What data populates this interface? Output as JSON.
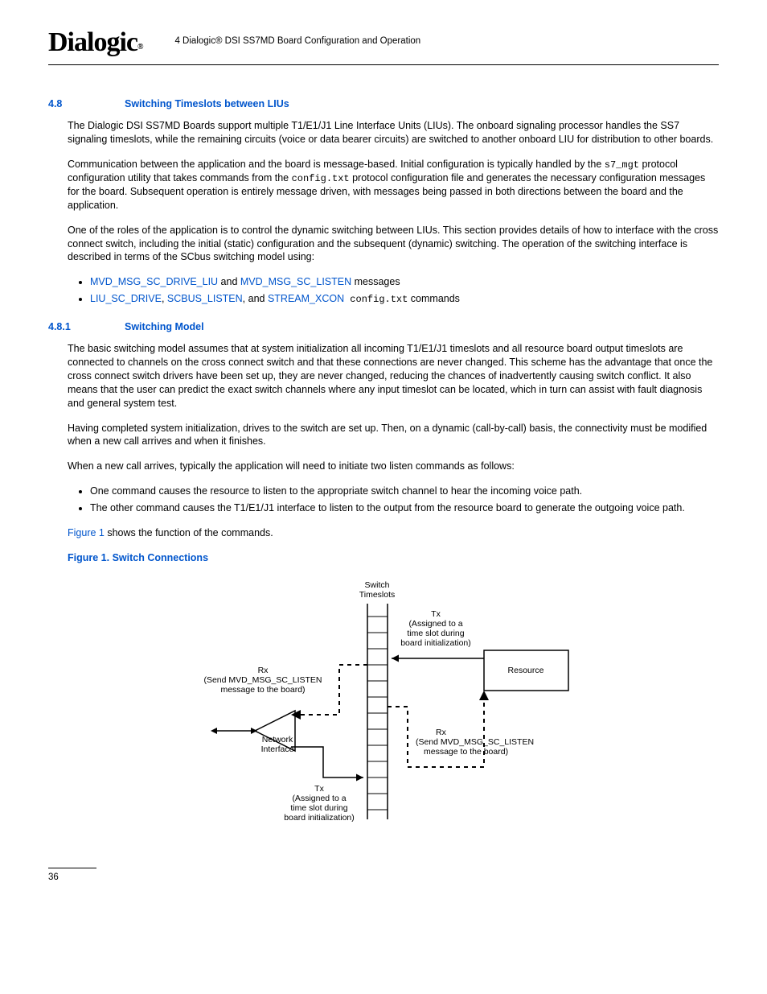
{
  "header": {
    "logo": "Dialogic",
    "running_title": "4 Dialogic® DSI SS7MD Board Configuration and Operation"
  },
  "sections": {
    "s48": {
      "num": "4.8",
      "title": "Switching Timeslots between LIUs",
      "paras": {
        "p1": "The Dialogic DSI SS7MD Boards support multiple T1/E1/J1 Line Interface Units (LIUs). The onboard signaling processor handles the SS7 signaling timeslots, while the remaining circuits (voice or data bearer circuits) are switched to another onboard LIU for distribution to other boards.",
        "p2a": "Communication between the application and the board is message-based. Initial configuration is typically handled by the ",
        "p2_code1": "s7_mgt",
        "p2b": " protocol configuration utility that takes commands from the ",
        "p2_code2": "config.txt",
        "p2c": " protocol configuration file and generates the necessary configuration messages for the board. Subsequent operation is entirely message driven, with messages being passed in both directions between the board and the application.",
        "p3": "One of the roles of the application is to control the dynamic switching between LIUs. This section provides details of how to interface with the cross connect switch, including the initial (static) configuration and the subsequent (dynamic) switching. The operation of the switching interface is described in terms of the SCbus switching model using:",
        "b1_link1": "MVD_MSG_SC_DRIVE_LIU",
        "b1_mid": " and ",
        "b1_link2": "MVD_MSG_SC_LISTEN",
        "b1_tail": " messages",
        "b2_link1": "LIU_SC_DRIVE",
        "b2_sep1": ", ",
        "b2_link2": "SCBUS_LISTEN",
        "b2_sep2": ", and ",
        "b2_link3": "STREAM_XCON",
        "b2_tail_code": " config.txt",
        "b2_tail": " commands"
      }
    },
    "s481": {
      "num": "4.8.1",
      "title": "Switching Model",
      "paras": {
        "p1": "The basic switching model assumes that at system initialization all incoming T1/E1/J1 timeslots and all resource board output timeslots are connected to channels on the cross connect switch and that these connections are never changed. This scheme has the advantage that once the cross connect switch drivers have been set up, they are never changed, reducing the chances of inadvertently causing switch conflict. It also means that the user can predict the exact switch channels where any input timeslot can be located, which in turn can assist with fault diagnosis and general system test.",
        "p2": "Having completed system initialization, drives to the switch are set up. Then, on a dynamic (call-by-call) basis, the connectivity must be modified when a new call arrives and when it finishes.",
        "p3": "When a new call arrives, typically the application will need to initiate two listen commands as follows:",
        "b1": "One command causes the resource to listen to the appropriate switch channel to hear the incoming voice path.",
        "b2": "The other command causes the T1/E1/J1 interface to listen to the output from the resource board to generate the outgoing voice path.",
        "p4_link": "Figure 1",
        "p4_tail": " shows the function of the commands."
      }
    }
  },
  "figure": {
    "caption": "Figure 1. Switch Connections",
    "labels": {
      "switch_timeslots_l1": "Switch",
      "switch_timeslots_l2": "Timeslots",
      "tx_top": "Tx",
      "tx_top_l1": "(Assigned to a",
      "tx_top_l2": "time slot during",
      "tx_top_l3": "board initialization)",
      "resource": "Resource",
      "rx_left": "Rx",
      "rx_left_l1": "(Send MVD_MSG_SC_LISTEN",
      "rx_left_l2": "message to the board)",
      "rx_right": "Rx",
      "rx_right_l1": "(Send MVD_MSG_SC_LISTEN",
      "rx_right_l2": "message to the board)",
      "network_l1": "Network",
      "network_l2": "Interface",
      "tx_bottom": "Tx",
      "tx_bottom_l1": "(Assigned to a",
      "tx_bottom_l2": "time slot during",
      "tx_bottom_l3": "board initialization)"
    }
  },
  "footer": {
    "page_number": "36"
  }
}
